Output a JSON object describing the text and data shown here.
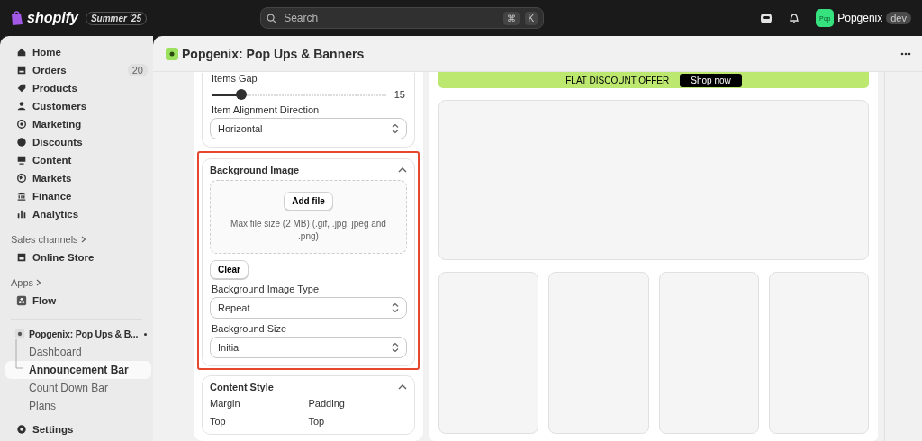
{
  "topbar": {
    "brand": "shopify",
    "badge": "Summer '25",
    "search": {
      "placeholder": "Search",
      "keys": [
        "⌘",
        "K"
      ]
    },
    "store": {
      "avatar": "Pop",
      "name": "Popgenix",
      "tag": "dev"
    }
  },
  "sidebar": {
    "items": [
      {
        "label": "Home",
        "selected": false
      },
      {
        "label": "Orders",
        "badge": "20",
        "selected": false
      },
      {
        "label": "Products",
        "selected": false
      },
      {
        "label": "Customers",
        "selected": false
      },
      {
        "label": "Marketing",
        "selected": false
      },
      {
        "label": "Discounts",
        "selected": false
      },
      {
        "label": "Content",
        "selected": false
      },
      {
        "label": "Markets",
        "selected": false
      },
      {
        "label": "Finance",
        "selected": false
      },
      {
        "label": "Analytics",
        "selected": false
      }
    ],
    "sales_channels": {
      "heading": "Sales channels",
      "items": [
        {
          "label": "Online Store",
          "selected": false
        }
      ]
    },
    "apps": {
      "heading": "Apps",
      "items": [
        {
          "label": "Flow",
          "selected": false
        }
      ]
    },
    "app_menu": {
      "label": "Popgenix: Pop Ups & B...",
      "pinned": true,
      "children": [
        {
          "label": "Dashboard",
          "selected": false
        },
        {
          "label": "Announcement Bar",
          "selected": true
        },
        {
          "label": "Count Down Bar",
          "selected": false
        },
        {
          "label": "Plans",
          "selected": false
        }
      ]
    },
    "settings": {
      "label": "Settings",
      "selected": false
    }
  },
  "page": {
    "title": "Popgenix: Pop Ups & Banners",
    "settings_panel": {
      "items_gap": {
        "label": "Items Gap",
        "level": 0.17,
        "reading": "15"
      },
      "alignment": {
        "label": "Item Alignment Direction",
        "value": "Horizontal"
      },
      "background_image": {
        "title": "Background Image",
        "expanded": true,
        "highlighted": true,
        "upload": {
          "button": "Add file",
          "hint": "Max file size (2 MB) (.gif, .jpg, jpeg and .png)"
        },
        "clear": "Clear",
        "type": {
          "label": "Background Image Type",
          "value": "Repeat"
        },
        "size": {
          "label": "Background Size",
          "value": "Initial"
        }
      },
      "content_style": {
        "title": "Content Style",
        "expanded": true,
        "columns": [
          {
            "label": "Margin",
            "side": "Top"
          },
          {
            "label": "Padding",
            "side": "Top"
          }
        ]
      }
    },
    "preview": {
      "banner": {
        "text": "FLAT DISCOUNT OFFER",
        "button": "Shop now"
      }
    }
  }
}
